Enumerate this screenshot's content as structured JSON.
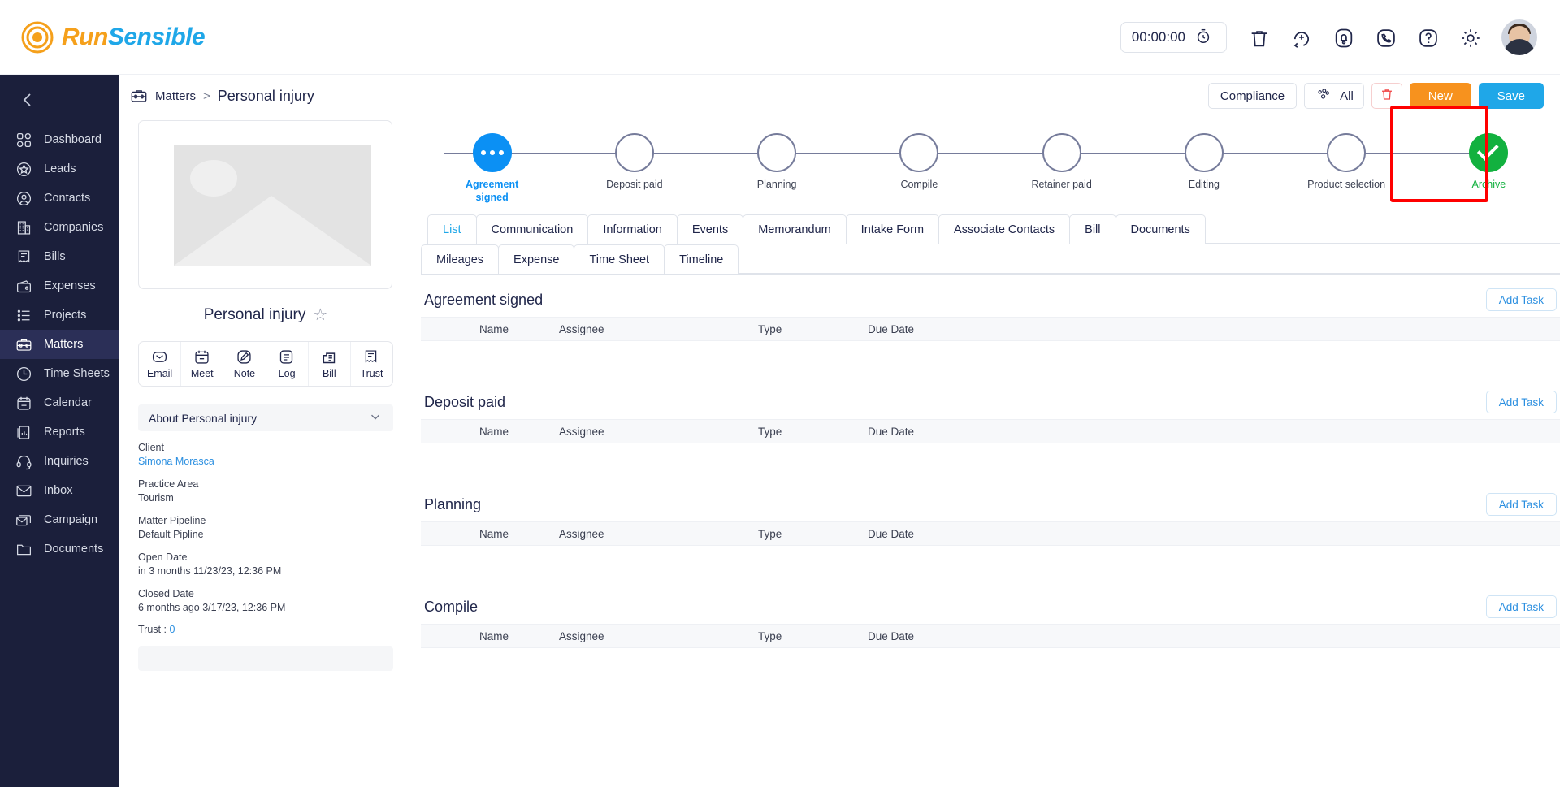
{
  "brand": {
    "run": "Run",
    "sensible": "Sensible"
  },
  "topbar": {
    "timer": "00:00:00",
    "icons": [
      "stopwatch-icon",
      "trash-icon",
      "add-icon",
      "bell-icon",
      "phone-icon",
      "help-icon",
      "settings-icon",
      "avatar"
    ]
  },
  "sidebar": {
    "items": [
      {
        "label": "Dashboard",
        "icon": "dashboard-icon",
        "active": false
      },
      {
        "label": "Leads",
        "icon": "star-circle-icon",
        "active": false
      },
      {
        "label": "Contacts",
        "icon": "user-circle-icon",
        "active": false
      },
      {
        "label": "Companies",
        "icon": "building-icon",
        "active": false
      },
      {
        "label": "Bills",
        "icon": "receipt-icon",
        "active": false
      },
      {
        "label": "Expenses",
        "icon": "wallet-icon",
        "active": false
      },
      {
        "label": "Projects",
        "icon": "list-icon",
        "active": false
      },
      {
        "label": "Matters",
        "icon": "briefcase-icon",
        "active": true
      },
      {
        "label": "Time Sheets",
        "icon": "clock-icon",
        "active": false
      },
      {
        "label": "Calendar",
        "icon": "calendar-icon",
        "active": false
      },
      {
        "label": "Reports",
        "icon": "report-icon",
        "active": false
      },
      {
        "label": "Inquiries",
        "icon": "headset-icon",
        "active": false
      },
      {
        "label": "Inbox",
        "icon": "envelope-icon",
        "active": false
      },
      {
        "label": "Campaign",
        "icon": "campaign-icon",
        "active": false
      },
      {
        "label": "Documents",
        "icon": "folder-icon",
        "active": false
      }
    ]
  },
  "breadcrumb": {
    "parent": "Matters",
    "separator": ">",
    "current": "Personal injury"
  },
  "actions": {
    "compliance": "Compliance",
    "all": "All",
    "new": "New",
    "save": "Save"
  },
  "matter": {
    "title": "Personal injury",
    "quick_actions": [
      {
        "label": "Email",
        "icon": "email-icon"
      },
      {
        "label": "Meet",
        "icon": "calendar-icon"
      },
      {
        "label": "Note",
        "icon": "note-pencil-icon"
      },
      {
        "label": "Log",
        "icon": "document-lines-icon"
      },
      {
        "label": "Bill",
        "icon": "bill-icon"
      },
      {
        "label": "Trust",
        "icon": "receipt-icon"
      }
    ],
    "about_header": "About Personal injury",
    "fields": [
      {
        "label": "Client",
        "value": "Simona Morasca",
        "link": true
      },
      {
        "label": "Practice Area",
        "value": "Tourism",
        "link": false
      },
      {
        "label": "Matter Pipeline",
        "value": "Default Pipline",
        "link": false
      },
      {
        "label": "Open Date",
        "value": "in 3 months 11/23/23, 12:36 PM",
        "link": false
      },
      {
        "label": "Closed Date",
        "value": "6 months ago 3/17/23, 12:36 PM",
        "link": false
      }
    ],
    "trust_label": "Trust :",
    "trust_value": "0"
  },
  "pipeline": {
    "steps": [
      {
        "label": "Agreement signed",
        "state": "current"
      },
      {
        "label": "Deposit paid",
        "state": "pending"
      },
      {
        "label": "Planning",
        "state": "pending"
      },
      {
        "label": "Compile",
        "state": "pending"
      },
      {
        "label": "Retainer paid",
        "state": "pending"
      },
      {
        "label": "Editing",
        "state": "pending"
      },
      {
        "label": "Product selection",
        "state": "pending"
      },
      {
        "label": "Archive",
        "state": "done"
      }
    ],
    "highlight_step": "Archive",
    "highlight_color": "#ff0000"
  },
  "tabs": {
    "row1": [
      {
        "label": "List",
        "active": true
      },
      {
        "label": "Communication",
        "active": false
      },
      {
        "label": "Information",
        "active": false
      },
      {
        "label": "Events",
        "active": false
      },
      {
        "label": "Memorandum",
        "active": false
      },
      {
        "label": "Intake Form",
        "active": false
      },
      {
        "label": "Associate Contacts",
        "active": false
      },
      {
        "label": "Bill",
        "active": false
      },
      {
        "label": "Documents",
        "active": false
      }
    ],
    "row2": [
      {
        "label": "Mileages",
        "active": false
      },
      {
        "label": "Expense",
        "active": false
      },
      {
        "label": "Time Sheet",
        "active": false
      },
      {
        "label": "Timeline",
        "active": false
      }
    ]
  },
  "task_columns": [
    "Name",
    "Assignee",
    "Type",
    "Due Date"
  ],
  "add_task_label": "Add Task",
  "task_groups": [
    {
      "title": "Agreement signed",
      "rows": []
    },
    {
      "title": "Deposit paid",
      "rows": []
    },
    {
      "title": "Planning",
      "rows": []
    },
    {
      "title": "Compile",
      "rows": []
    }
  ],
  "colors": {
    "sidebar_bg": "#1b1f3b",
    "accent_blue": "#1FA7E8",
    "accent_orange": "#F7921E",
    "done_green": "#12b13f",
    "current_blue": "#0b90f4"
  }
}
